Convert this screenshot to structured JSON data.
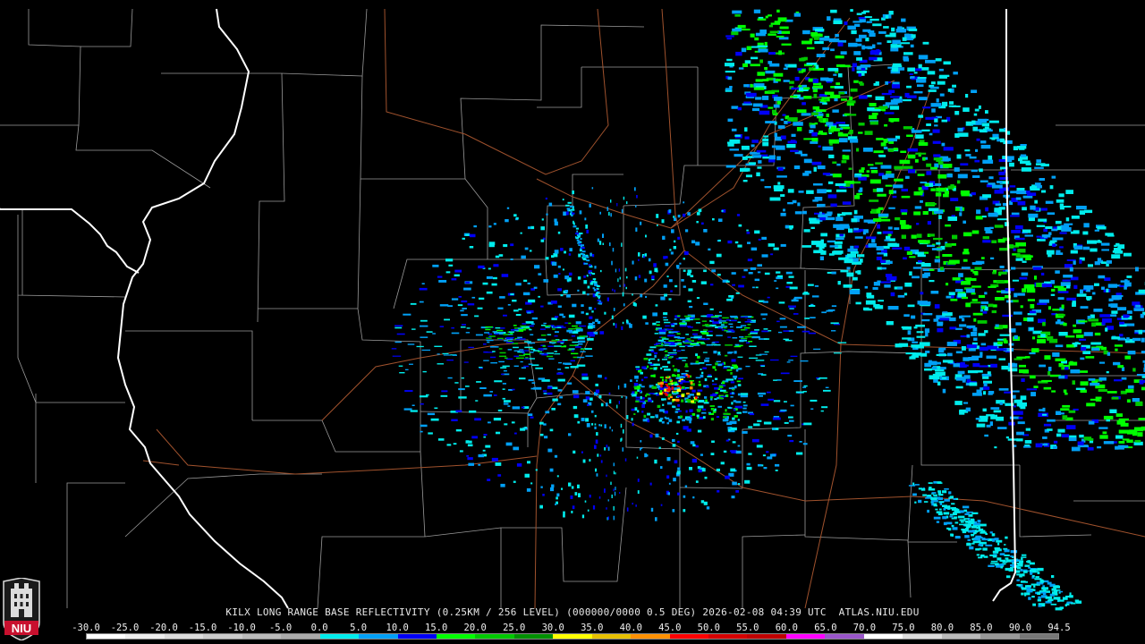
{
  "product": {
    "text": "KILX LONG RANGE BASE REFLECTIVITY (0.25KM / 256 LEVEL) (000000/0000 0.5 DEG) 2026-02-08 04:39 UTC  ATLAS.NIU.EDU"
  },
  "logo": {
    "text": "NIU",
    "color": "#c8102e"
  },
  "colorbar": {
    "labels": [
      "-30.0",
      "-25.0",
      "-20.0",
      "-15.0",
      "-10.0",
      "-5.0",
      "0.0",
      "5.0",
      "10.0",
      "15.0",
      "20.0",
      "25.0",
      "30.0",
      "35.0",
      "40.0",
      "45.0",
      "50.0",
      "55.0",
      "60.0",
      "65.0",
      "70.0",
      "75.0",
      "80.0",
      "85.0",
      "90.0",
      "94.5"
    ],
    "colors": [
      "#ffffff",
      "#eeeeee",
      "#dddddd",
      "#cccccc",
      "#bbbbbb",
      "#aaaaaa",
      "#00ecec",
      "#01a0f6",
      "#0000f6",
      "#00ff00",
      "#00c800",
      "#009000",
      "#ffff00",
      "#e7c000",
      "#ff9000",
      "#ff0000",
      "#d60000",
      "#c00000",
      "#ff00ff",
      "#9955c9",
      "#ffffff",
      "#dddddd",
      "#bbbbbb",
      "#999999",
      "#777777"
    ]
  },
  "map": {
    "state_border_color": "#ffffff",
    "county_line_color": "#9a9a9a",
    "highway_color": "#a0522d"
  }
}
